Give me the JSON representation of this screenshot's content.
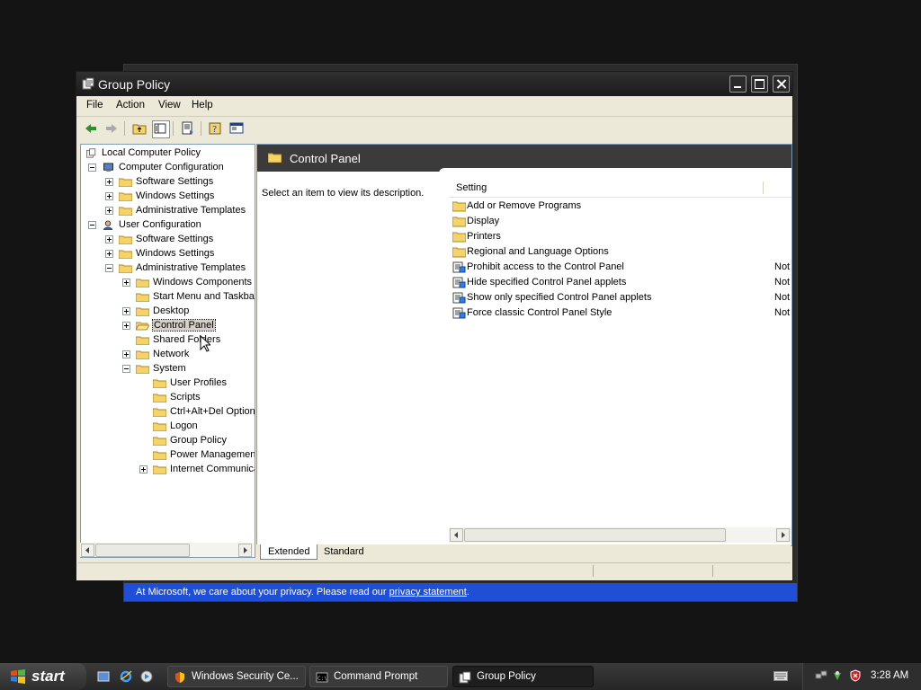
{
  "background_window": {
    "privacy_text": "At Microsoft, we care about your privacy.  Please read our ",
    "privacy_link": "privacy statement",
    "privacy_end": "."
  },
  "window": {
    "title": "Group Policy",
    "menu": [
      "File",
      "Action",
      "View",
      "Help"
    ],
    "toolbar_icons": [
      "back-arrow-icon",
      "forward-arrow-icon",
      "up-folder-icon",
      "show-hide-tree-icon",
      "export-list-icon",
      "help-icon",
      "properties-icon"
    ]
  },
  "tree": {
    "root": "Local Computer Policy",
    "computer_config": "Computer Configuration",
    "cc_software": "Software Settings",
    "cc_windows": "Windows Settings",
    "cc_admin": "Administrative Templates",
    "user_config": "User Configuration",
    "uc_software": "Software Settings",
    "uc_windows": "Windows Settings",
    "uc_admin": "Administrative Templates",
    "windows_components": "Windows Components",
    "start_menu": "Start Menu and Taskbar",
    "desktop": "Desktop",
    "control_panel": "Control Panel",
    "shared_folders": "Shared Folders",
    "network": "Network",
    "system": "System",
    "user_profiles": "User Profiles",
    "scripts": "Scripts",
    "ctrl_alt_del": "Ctrl+Alt+Del Options",
    "logon": "Logon",
    "group_policy": "Group Policy",
    "power_management": "Power Management",
    "internet_communication": "Internet Communication"
  },
  "right_pane": {
    "header_title": "Control Panel",
    "description": "Select an item to view its description.",
    "column_setting": "Setting",
    "rows": [
      {
        "label": "Add or Remove Programs",
        "type": "folder",
        "state": ""
      },
      {
        "label": "Display",
        "type": "folder",
        "state": ""
      },
      {
        "label": "Printers",
        "type": "folder",
        "state": ""
      },
      {
        "label": "Regional and Language Options",
        "type": "folder",
        "state": ""
      },
      {
        "label": "Prohibit access to the Control Panel",
        "type": "policy",
        "state": "Not"
      },
      {
        "label": "Hide specified Control Panel applets",
        "type": "policy",
        "state": "Not"
      },
      {
        "label": "Show only specified Control Panel applets",
        "type": "policy",
        "state": "Not"
      },
      {
        "label": "Force classic Control Panel Style",
        "type": "policy",
        "state": "Not"
      }
    ],
    "tabs": [
      "Extended",
      "Standard"
    ],
    "active_tab": "Extended"
  },
  "taskbar": {
    "start_label": "start",
    "tasks": [
      "Windows Security Ce...",
      "Command Prompt",
      "Group Policy"
    ],
    "active_task": "Group Policy",
    "clock": "3:28 AM"
  },
  "colors": {
    "titlebar": "#222222",
    "privacy_bar": "#1f4fd6",
    "folder": "#f4d36b"
  }
}
